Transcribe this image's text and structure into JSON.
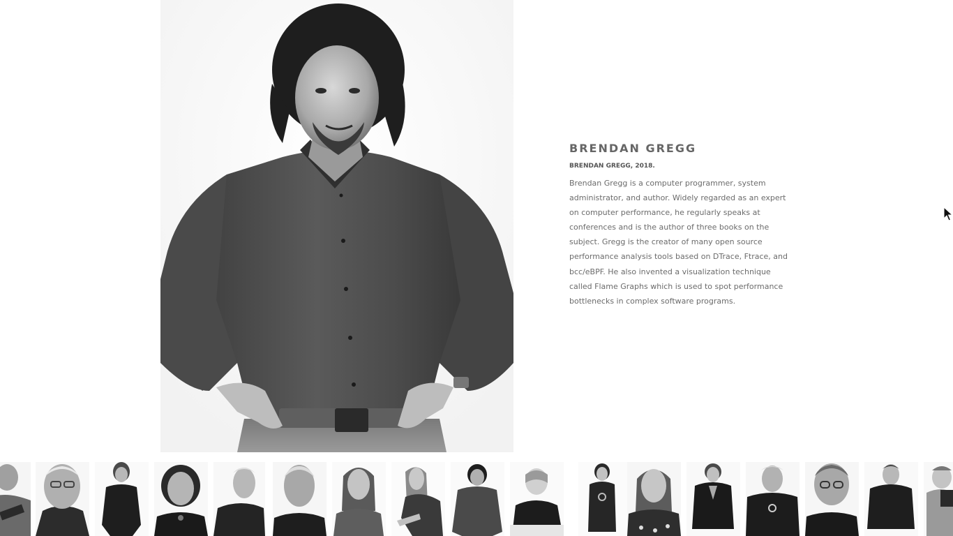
{
  "profile": {
    "name": "BRENDAN GREGG",
    "caption": "BRENDAN GREGG, 2018.",
    "bio": "Brendan Gregg is a computer programmer, system administrator, and author. Widely regarded as an expert on computer performance, he regularly speaks at conferences and is the author of three books on the subject. Gregg is the creator of many open source performance analysis tools based on DTrace, Ftrace, and bcc/eBPF. He also invented a visualization technique called Flame Graphs which is used to spot performance bottlenecks in complex software programs."
  },
  "colors": {
    "name_text": "#666666",
    "body_text": "#6b6b6b",
    "background": "#ffffff"
  },
  "thumbnails": {
    "count": 17,
    "style": "black-and-white portrait photos"
  }
}
